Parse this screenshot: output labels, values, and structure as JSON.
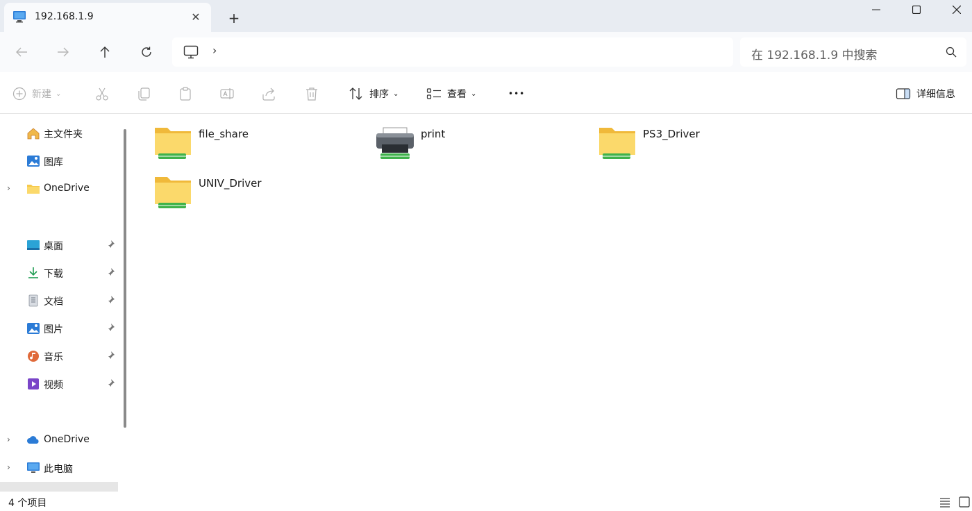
{
  "window": {
    "tab_title": "192.168.1.9",
    "new_tab": "+",
    "close_tab": "✕"
  },
  "nav": {
    "search_placeholder": "在 192.168.1.9 中搜索",
    "address_separator": "›"
  },
  "toolbar": {
    "new_label": "新建",
    "sort_label": "排序",
    "view_label": "查看",
    "more_label": "•••",
    "details_label": "详细信息"
  },
  "sidebar": {
    "items": [
      {
        "label": "主文件夹",
        "icon": "home-icon"
      },
      {
        "label": "图库",
        "icon": "gallery-icon"
      },
      {
        "label": "OneDrive",
        "icon": "folder-icon"
      },
      {
        "label": "桌面",
        "icon": "desktop-icon"
      },
      {
        "label": "下载",
        "icon": "download-icon"
      },
      {
        "label": "文档",
        "icon": "document-icon"
      },
      {
        "label": "图片",
        "icon": "pictures-icon"
      },
      {
        "label": "音乐",
        "icon": "music-icon"
      },
      {
        "label": "视频",
        "icon": "video-icon"
      },
      {
        "label": "OneDrive",
        "icon": "cloud-icon"
      },
      {
        "label": "此电脑",
        "icon": "computer-icon"
      }
    ]
  },
  "content": {
    "items": [
      {
        "name": "file_share",
        "icon": "network-folder-icon"
      },
      {
        "name": "print",
        "icon": "printer-icon"
      },
      {
        "name": "PS3_Driver",
        "icon": "network-folder-icon"
      },
      {
        "name": "UNIV_Driver",
        "icon": "network-folder-icon"
      }
    ]
  },
  "status": {
    "count_text": "4 个项目"
  },
  "colors": {
    "folder": "#f6c94b",
    "share_bar": "#3fb24b",
    "titlebar": "#e8ecf2"
  }
}
